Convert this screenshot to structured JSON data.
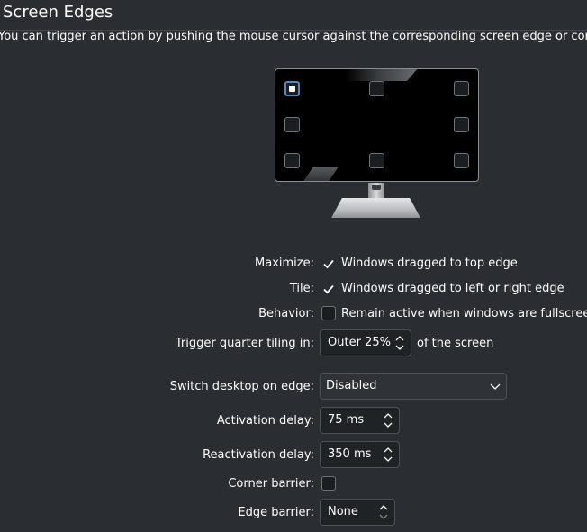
{
  "header": {
    "title": "Screen Edges",
    "description": "You can trigger an action by pushing the mouse cursor against the corresponding screen edge or corner."
  },
  "monitor": {
    "active_corner": "top-left",
    "corners": [
      "top-left",
      "top-center",
      "top-right",
      "middle-left",
      "middle-right",
      "bottom-left",
      "bottom-center",
      "bottom-right"
    ]
  },
  "form": {
    "maximize": {
      "label": "Maximize:",
      "text": "Windows dragged to top edge",
      "checked": true
    },
    "tile": {
      "label": "Tile:",
      "text": "Windows dragged to left or right edge",
      "checked": true
    },
    "behavior": {
      "label": "Behavior:",
      "text": "Remain active when windows are fullscreen",
      "checked": false
    },
    "quarter_tiling": {
      "label": "Trigger quarter tiling in:",
      "value": "Outer 25%",
      "suffix": "of the screen"
    },
    "switch_desktop": {
      "label": "Switch desktop on edge:",
      "value": "Disabled"
    },
    "activation_delay": {
      "label": "Activation delay:",
      "value": "75 ms"
    },
    "reactivation_delay": {
      "label": "Reactivation delay:",
      "value": "350 ms"
    },
    "corner_barrier": {
      "label": "Corner barrier:",
      "checked": false
    },
    "edge_barrier": {
      "label": "Edge barrier:",
      "value": "None"
    }
  },
  "colors": {
    "background": "#2a2e32",
    "accent": "#3daee9",
    "text": "#fcfcfc"
  }
}
